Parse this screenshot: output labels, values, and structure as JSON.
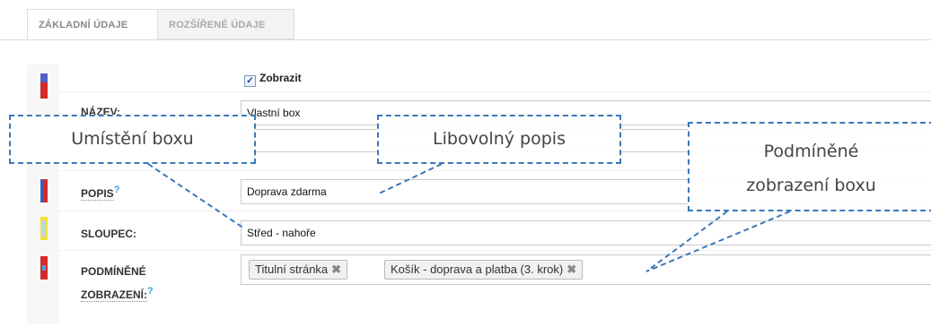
{
  "tabs": [
    {
      "label": "ZÁKLADNÍ ÚDAJE",
      "active": true
    },
    {
      "label": "ROZŠÍŘENÉ ÚDAJE",
      "active": false
    }
  ],
  "form": {
    "show_checkbox": {
      "label": "Zobrazit",
      "checked": true
    },
    "name": {
      "label": "NÁZEV:",
      "value": "Vlastní box"
    },
    "description": {
      "label": "POPIS",
      "help": "?",
      "value": "Doprava zdarma"
    },
    "column": {
      "label": "SLOUPEC:",
      "value": "Střed - nahoře"
    },
    "conditional": {
      "label_line1": "PODMÍNĚNÉ",
      "label_line2": "ZOBRAZENÍ:",
      "help": "?",
      "tags": [
        {
          "label": "Titulní stránka",
          "remove": "✖"
        },
        {
          "label": "Košík - doprava a platba (3. krok)",
          "remove": "✖"
        }
      ]
    }
  },
  "callouts": {
    "placement": "Umístění boxu",
    "description": "Libovolný popis",
    "conditional_line1": "Podmíněné",
    "conditional_line2": "zobrazení boxu"
  },
  "colors": {
    "callout_border": "#3d78b8",
    "help_icon": "#2aa7d8"
  }
}
